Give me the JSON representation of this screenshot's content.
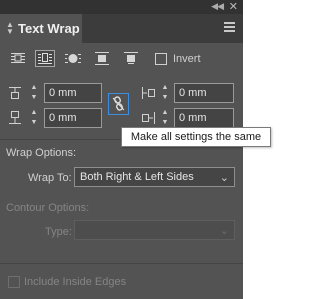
{
  "panel": {
    "title": "Text Wrap",
    "icons": {
      "collapse": "double-chevron-left",
      "close": "close-x",
      "menu": "hamburger-menu"
    }
  },
  "wrap_buttons": [
    {
      "name": "no-text-wrap",
      "selected": false
    },
    {
      "name": "wrap-around-bounding-box",
      "selected": true
    },
    {
      "name": "wrap-around-object-shape",
      "selected": false
    },
    {
      "name": "jump-object",
      "selected": false
    },
    {
      "name": "jump-to-next-column",
      "selected": false
    }
  ],
  "invert": {
    "label": "Invert",
    "checked": false
  },
  "offsets": {
    "top": "0 mm",
    "bottom": "0 mm",
    "left": "0 mm",
    "right": "0 mm"
  },
  "link_button": {
    "icon": "chain-link-broken"
  },
  "tooltip": {
    "text": "Make all settings the same"
  },
  "wrap_options": {
    "heading": "Wrap Options:",
    "wrap_to_label": "Wrap To:",
    "wrap_to_value": "Both Right & Left Sides"
  },
  "contour_options": {
    "heading": "Contour Options:",
    "type_label": "Type:",
    "type_value": ""
  },
  "include_inside_edges": {
    "label": "Include Inside Edges",
    "checked": false,
    "disabled": true
  },
  "colors": {
    "panel_bg": "#535353",
    "tab_bar": "#3c3c3c",
    "accent": "#3e8ee0",
    "tooltip_bg": "#ffffff"
  }
}
